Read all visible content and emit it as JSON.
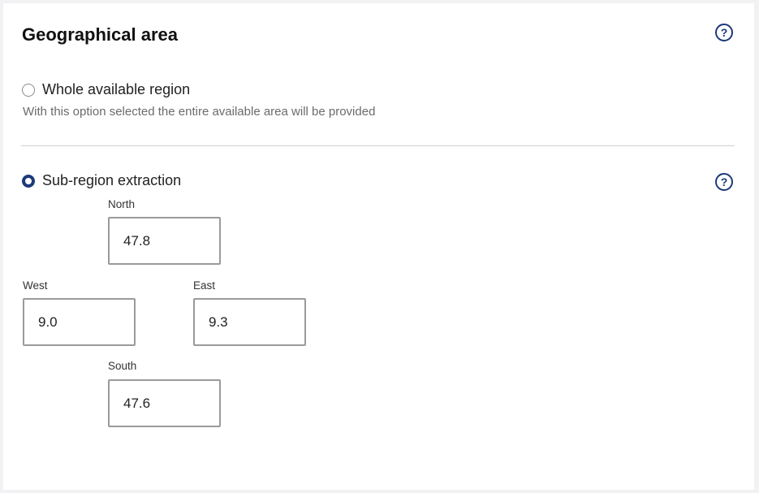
{
  "section": {
    "title": "Geographical area",
    "help_icon": "question-circle-icon"
  },
  "options": [
    {
      "label": "Whole available region",
      "description": "With this option selected the entire available area will be provided",
      "selected": false
    },
    {
      "label": "Sub-region extraction",
      "selected": true
    }
  ],
  "coordinates": {
    "north": {
      "label": "North",
      "value": "47.8"
    },
    "west": {
      "label": "West",
      "value": "9.0"
    },
    "east": {
      "label": "East",
      "value": "9.3"
    },
    "south": {
      "label": "South",
      "value": "47.6"
    }
  },
  "colors": {
    "accent": "#1d3a7a",
    "border": "#9a9a9a",
    "background": "#f2f2f4"
  }
}
